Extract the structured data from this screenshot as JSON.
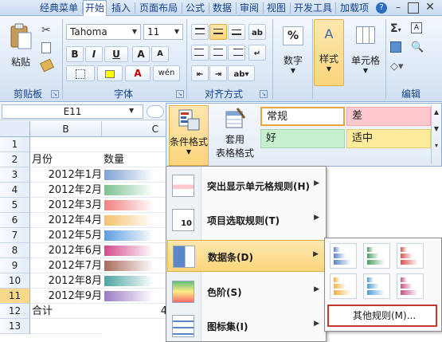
{
  "tabs": [
    "经典菜单",
    "开始",
    "插入",
    "页面布局",
    "公式",
    "数据",
    "审阅",
    "视图",
    "开发工具",
    "加载项"
  ],
  "active_tab": "开始",
  "ribbon": {
    "clipboard": {
      "paste_label": "粘贴",
      "group_label": "剪贴板"
    },
    "font": {
      "font_name": "Tahoma",
      "font_size": "11",
      "bold": "B",
      "italic": "I",
      "underline": "U",
      "grow": "A",
      "shrink": "A",
      "font_color_letter": "A",
      "phonetic": "wén",
      "group_label": "字体"
    },
    "alignment": {
      "group_label": "对齐方式"
    },
    "number": {
      "percent": "%",
      "label": "数字"
    },
    "styles": {
      "label": "样式"
    },
    "cells": {
      "label": "单元格"
    },
    "editing": {
      "label": "编辑",
      "sigma": "Σ"
    }
  },
  "namebox": "E11",
  "styles_gallery": {
    "conditional_format_label": "条件格式",
    "table_format_label_line1": "套用",
    "table_format_label_line2": "表格格式",
    "cells": [
      {
        "text": "常规",
        "bg": "#ffffff",
        "border": "#e9a33f"
      },
      {
        "text": "差",
        "bg": "#ffc7ce",
        "border": "#f0a7b0"
      },
      {
        "text": "好",
        "bg": "#c6efce",
        "border": "#a4d7ae"
      },
      {
        "text": "适中",
        "bg": "#ffeb9c",
        "border": "#e6cf7a"
      }
    ]
  },
  "grid": {
    "columns": [
      "B",
      "C"
    ],
    "row_numbers": [
      "1",
      "2",
      "3",
      "4",
      "5",
      "6",
      "7",
      "8",
      "9",
      "10",
      "11",
      "12",
      "13"
    ],
    "selected_row": "11",
    "header_row": {
      "b": "月份",
      "c": "数量"
    },
    "months": [
      "2012年1月",
      "2012年2月",
      "2012年3月",
      "2012年4月",
      "2012年5月",
      "2012年6月",
      "2012年7月",
      "2012年8月",
      "2012年9月"
    ],
    "bar_colors": [
      "#7fa3d4",
      "#7cc291",
      "#f08080",
      "#f5c06a",
      "#5b9de0",
      "#d44a8c",
      "#a96a5c",
      "#4aa6a3",
      "#9b7bc4"
    ],
    "total_label": "合计",
    "total_partial": "4"
  },
  "menu": {
    "items": [
      {
        "label": "突出显示单元格规则(H)",
        "has_arrow": true
      },
      {
        "label": "项目选取规则(T)",
        "has_arrow": true
      },
      {
        "label": "数据条(D)",
        "has_arrow": true,
        "highlighted": true
      },
      {
        "label": "色阶(S)",
        "has_arrow": true
      },
      {
        "label": "图标集(I)",
        "has_arrow": true
      }
    ],
    "arrow": "▶"
  },
  "submenu": {
    "bar_colors": [
      "#5b86c7",
      "#4aa05e",
      "#d9534f",
      "#f0b43c",
      "#4d9ad8",
      "#c6518c"
    ],
    "more_rules": "其他规则(M)..."
  }
}
